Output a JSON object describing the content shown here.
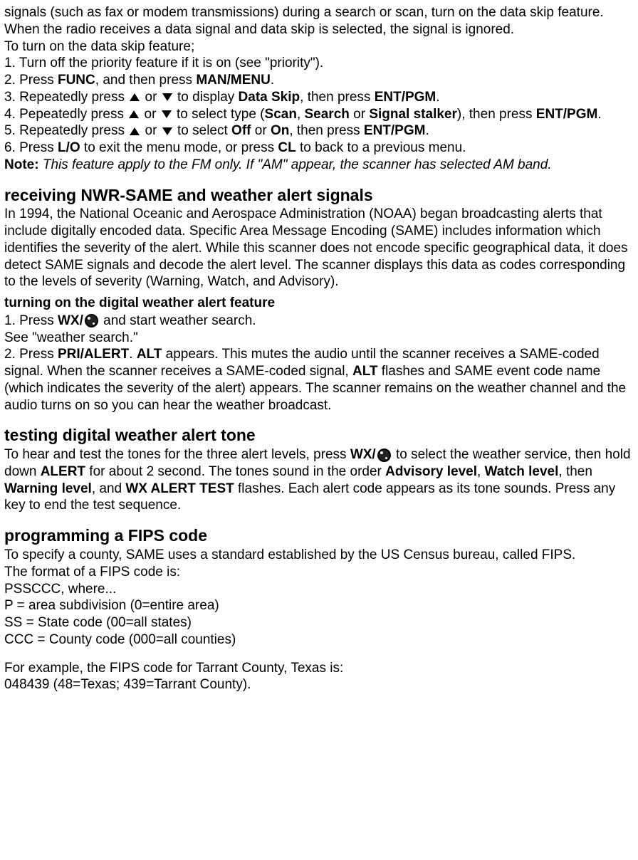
{
  "intro": {
    "p1": "signals (such as fax or modem transmissions) during a search or scan, turn on the data skip feature. When the radio receives a data signal and data skip is selected, the signal is ignored.",
    "p2": "To turn on the data skip feature;",
    "step1": "1. Turn off the priority feature if it is on (see \"priority\").",
    "step2a": "2. Press ",
    "step2b": "FUNC",
    "step2c": ", and then press ",
    "step2d": "MAN/MENU",
    "step2e": ".",
    "step3a": "3. Repeatedly press ",
    "step3b": " or ",
    "step3c": " to display ",
    "step3d": "Data Skip",
    "step3e": ", then press ",
    "step3f": "ENT/PGM",
    "step3g": ".",
    "step4a": "4. Pepeatedly press ",
    "step4b": " or ",
    "step4c": " to select type (",
    "step4d": "Scan",
    "step4e": ", ",
    "step4f": "Search",
    "step4g": " or ",
    "step4h": "Signal stalker",
    "step4i": "), then press ",
    "step4j": "ENT/PGM",
    "step4k": ".",
    "step5a": "5. Repeatedly press ",
    "step5b": " or ",
    "step5c": " to select ",
    "step5d": "Off",
    "step5e": " or ",
    "step5f": "On",
    "step5g": ", then press ",
    "step5h": "ENT/PGM",
    "step5i": ".",
    "step6a": "6. Press ",
    "step6b": "L/O",
    "step6c": " to exit the menu mode, or press ",
    "step6d": "CL",
    "step6e": " to back to a previous menu.",
    "note_label": "Note:",
    "note_text": " This feature apply to the FM only. If \"AM\" appear, the scanner has selected AM band."
  },
  "nwr": {
    "heading": "receiving NWR-SAME and weather alert signals",
    "body": "In 1994, the National Oceanic and Aerospace Administration (NOAA) began broadcasting alerts that include digitally encoded data. Specific Area Message Encoding (SAME) includes information which identifies the severity of the alert. While this scanner does not encode specific geographical data, it does detect SAME signals and decode the alert level. The scanner displays this data as codes corresponding to the levels of severity (Warning, Watch, and Advisory)."
  },
  "turnon": {
    "heading": "turning on the digital weather alert feature",
    "s1a": "1. Press ",
    "s1b": "WX/",
    "s1c": " and start weather search.",
    "s1d": "See \"weather search.\"",
    "s2a": "2. Press ",
    "s2b": "PRI/ALERT",
    "s2c": ". ",
    "s2d": "ALT",
    "s2e": " appears. This mutes the audio until the scanner receives a SAME-coded signal. When the scanner receives a SAME-coded signal, ",
    "s2f": "ALT",
    "s2g": " flashes and SAME event code name (which indicates the severity of the alert) appears. The scanner remains on the weather channel and the audio turns on so you can hear the weather broadcast."
  },
  "testing": {
    "heading": "testing digital weather alert tone",
    "t1a": "To hear and test the tones for the three alert levels, press ",
    "t1b": "WX/",
    "t1c": " to select the weather service, then hold down ",
    "t1d": "ALERT",
    "t1e": " for about 2 second. The tones sound in the order ",
    "t1f": "Advisory level",
    "t1g": ", ",
    "t1h": "Watch level",
    "t1i": ", then ",
    "t1j": "Warning level",
    "t1k": ", and ",
    "t1l": "WX ALERT TEST",
    "t1m": " flashes. Each alert code appears as its tone sounds. Press any key to end the test sequence."
  },
  "fips": {
    "heading": "programming a FIPS code",
    "p1": "To specify a county, SAME uses a standard established by the US Census bureau, called FIPS.",
    "p2": "The format of a FIPS code is:",
    "p3": "PSSCCC, where...",
    "p4": "P = area subdivision (0=entire area)",
    "p5": "SS = State code (00=all states)",
    "p6": "CCC = County code (000=all counties)",
    "p7": "For example, the FIPS code for Tarrant County, Texas is:",
    "p8": "048439 (48=Texas; 439=Tarrant County)."
  }
}
